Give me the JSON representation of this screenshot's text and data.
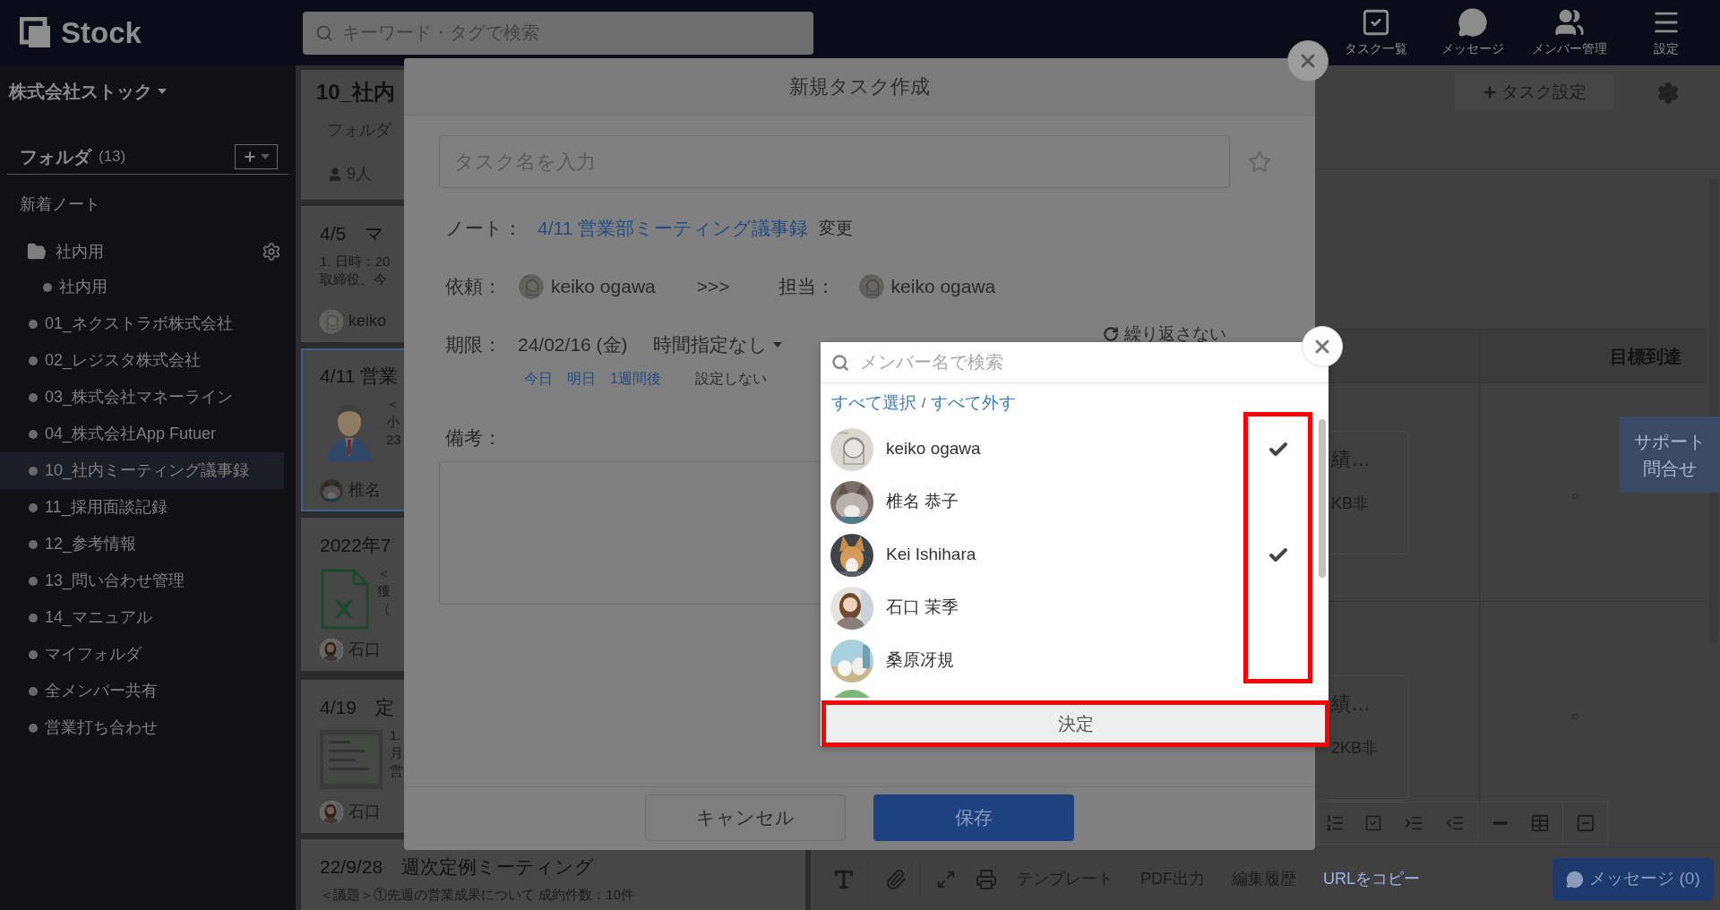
{
  "app": {
    "logo": "Stock"
  },
  "search": {
    "placeholder": "キーワード・タグで検索"
  },
  "nav": [
    {
      "label": "タスク一覧",
      "kind": "tasks"
    },
    {
      "label": "メッセージ",
      "kind": "messages"
    },
    {
      "label": "メンバー管理",
      "kind": "members"
    },
    {
      "label": "設定",
      "kind": "settings"
    }
  ],
  "sidebar": {
    "company": "株式会社ストック",
    "folder_header": "フォルダ",
    "folder_count": "(13)",
    "new_notes": "新着ノート",
    "group": {
      "label": "社内用",
      "expanded": true,
      "children": [
        {
          "label": "社内用",
          "selected": false
        }
      ]
    },
    "folders": [
      {
        "label": "01_ネクストラボ株式会社",
        "selected": false
      },
      {
        "label": "02_レジスタ株式会社",
        "selected": false
      },
      {
        "label": "03_株式会社マネーライン",
        "selected": false
      },
      {
        "label": "04_株式会社App Futuer",
        "selected": false
      },
      {
        "label": "10_社内ミーティング議事録",
        "selected": true
      },
      {
        "label": "11_採用面談記録",
        "selected": false
      },
      {
        "label": "12_参考情報",
        "selected": false
      },
      {
        "label": "13_問い合わせ管理",
        "selected": false
      },
      {
        "label": "14_マニュアル",
        "selected": false
      },
      {
        "label": "マイフォルダ",
        "selected": false
      },
      {
        "label": "全メンバー共有",
        "selected": false
      },
      {
        "label": "営業打ち合わせ",
        "selected": false
      }
    ]
  },
  "note_list": {
    "title": "10_社内",
    "subtitle": "フォルダ",
    "members": "9人",
    "cards": [
      {
        "title": "4/5　マ",
        "lines": [
          "1. 日時：20",
          "取締役、今"
        ],
        "author": "keiko",
        "kind": "text",
        "selected": false
      },
      {
        "title": "4/11 営業",
        "lines": [
          "＜",
          "小",
          "23"
        ],
        "author": "椎名",
        "kind": "illustration",
        "selected": true
      },
      {
        "title": "2022年7",
        "lines": [
          "＜",
          "獲",
          "（"
        ],
        "author": "石口",
        "kind": "spreadsheet",
        "selected": false
      },
      {
        "title": "4/19　定",
        "lines": [
          "1.",
          "月",
          "営"
        ],
        "author": "石口",
        "selected": false
      },
      {
        "title": "22/9/28　週次定例ミーティング",
        "lines": [
          "＜議題＞①先週の営業成果について 成約件数：10件"
        ],
        "kind": "text",
        "selected": false
      }
    ]
  },
  "task_settings": "タスク設定",
  "table": {
    "header": "目標到達",
    "cells": [
      {
        "title": "績…",
        "size": "KB非",
        "mark": "○"
      },
      {
        "title": "績…",
        "size": "2KB非",
        "mark": "○"
      }
    ]
  },
  "support": [
    "サポート",
    "問合せ"
  ],
  "editor_toolbar": [
    {
      "label": "テンプレート",
      "kind": "plain"
    },
    {
      "label": "PDF出力",
      "kind": "plain"
    },
    {
      "label": "編集履歴",
      "kind": "plain"
    },
    {
      "label": "URLをコピー",
      "kind": "link"
    }
  ],
  "message_button": "メッセージ (0)",
  "modal": {
    "title": "新規タスク作成",
    "task_name": {
      "placeholder": "タスク名を入力"
    },
    "starred": false,
    "note": {
      "label": "ノート：",
      "link": "4/11 営業部ミーティング議事録",
      "change": "変更"
    },
    "requester": {
      "label": "依頼：",
      "name": "keiko ogawa"
    },
    "arrow": ">>>",
    "assignee": {
      "label": "担当：",
      "name": "keiko ogawa"
    },
    "due": {
      "label": "期限：",
      "date": "24/02/16 (金)",
      "time": "時間指定なし",
      "repeat": "繰り返さない",
      "quick": [
        "今日",
        "明日",
        "1週間後"
      ],
      "clear": "設定しない"
    },
    "memo": {
      "label": "備考："
    },
    "buttons": {
      "cancel": "キャンセル",
      "save": "保存"
    }
  },
  "member_picker": {
    "search": {
      "placeholder": "メンバー名で検索"
    },
    "select_all": "すべて選択",
    "separator": "/",
    "deselect_all": "すべて外す",
    "members": [
      {
        "name": "keiko ogawa",
        "checked": true
      },
      {
        "name": "椎名 恭子",
        "checked": false
      },
      {
        "name": "Kei Ishihara",
        "checked": true
      },
      {
        "name": "石口 茉季",
        "checked": false
      },
      {
        "name": "桑原冴規",
        "checked": false
      }
    ],
    "confirm": "決定"
  }
}
